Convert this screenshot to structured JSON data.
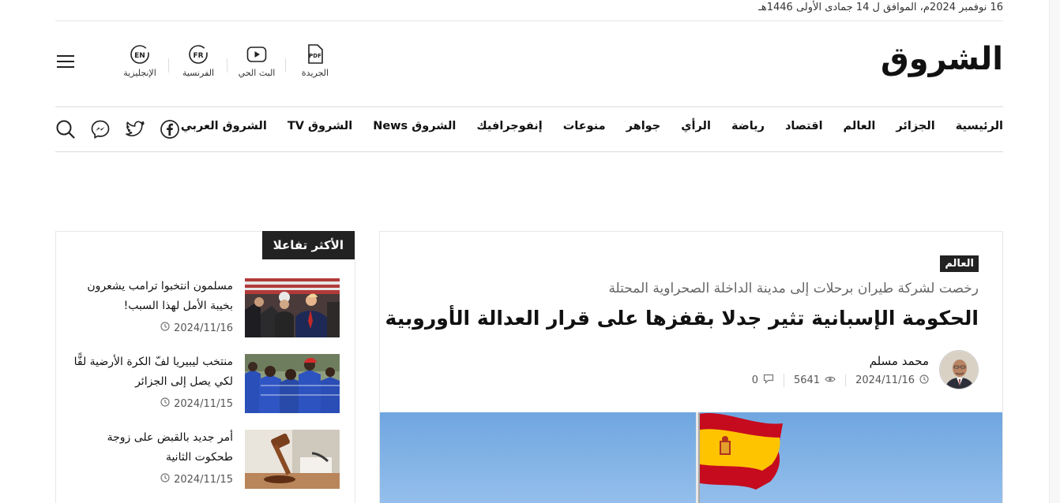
{
  "header": {
    "date_line": "16 نوفمبر 2024م، الموافق ل 14 جمادى الأولى 1446هـ",
    "logo_text": "الشروق",
    "quick_links": [
      {
        "label": "الجريدة",
        "icon": "pdf-icon",
        "glyph": "PDF"
      },
      {
        "label": "البث الحي",
        "icon": "play-icon",
        "glyph": ""
      },
      {
        "label": "الفرنسية",
        "icon": "fr-icon",
        "glyph": "FR"
      },
      {
        "label": "الإنجليزية",
        "icon": "en-icon",
        "glyph": "EN"
      }
    ]
  },
  "nav": {
    "items": [
      "الرئيسية",
      "الجزائر",
      "العالم",
      "اقتصاد",
      "رياضة",
      "الرأي",
      "جواهر",
      "منوعات",
      "إنفوجرافيك",
      "الشروق News",
      "الشروق TV",
      "الشروق العربي"
    ]
  },
  "social": [
    "facebook-icon",
    "twitter-icon",
    "messenger-icon",
    "search-icon"
  ],
  "sidebar": {
    "title": "الأكثر تفاعلا",
    "items": [
      {
        "title": "مسلمون انتخبوا ترامب يشعرون بخيبة الأمل لهذا السبب!",
        "date": "2024/11/16"
      },
      {
        "title": "منتخب ليبيريا لفّ الكرة الأرضية لفًّا لكي يصل إلى الجزائر",
        "date": "2024/11/15"
      },
      {
        "title": "أمر جديد بالقبض على زوجة طحكوت الثانية",
        "date": "2024/11/15"
      }
    ]
  },
  "article": {
    "category": "العالم",
    "subtitle": "رخصت لشركة طيران برحلات إلى مدينة الداخلة الصحراوية المحتلة",
    "headline": "الحكومة الإسبانية تثير جدلا بقفزها على قرار العدالة الأوروبية",
    "author": "محمد مسلم",
    "date": "2024/11/16",
    "views": "5641",
    "comments": "0"
  },
  "colors": {
    "accent_dark": "#222222",
    "sky": "#7fb1e4",
    "flag_red": "#c60b1e",
    "flag_yellow": "#ffc400"
  }
}
